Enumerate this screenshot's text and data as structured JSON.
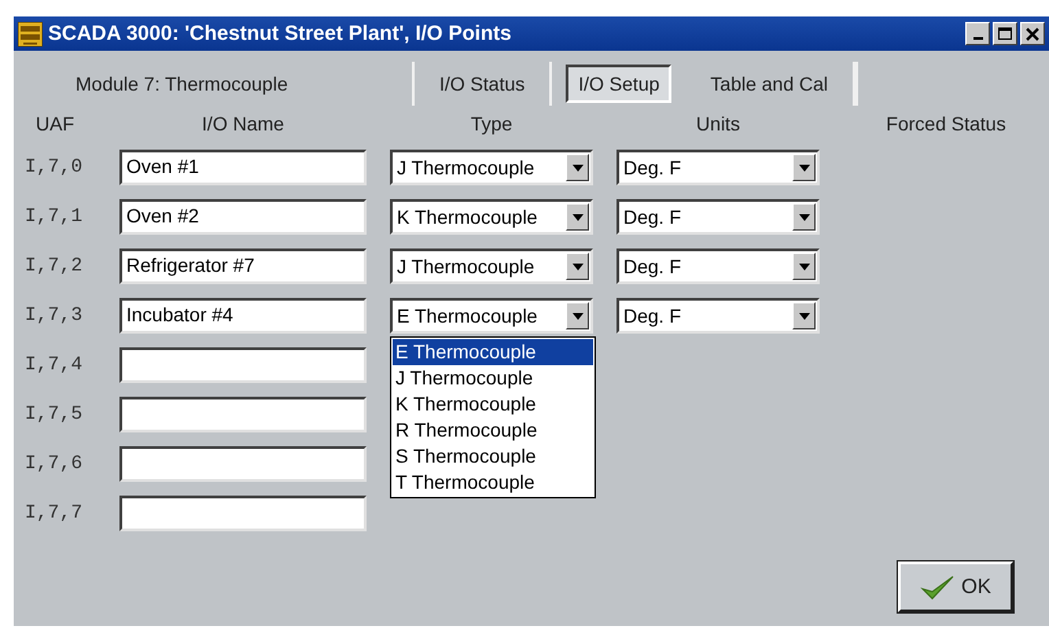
{
  "window": {
    "title": "SCADA 3000: 'Chestnut Street Plant', I/O Points"
  },
  "module_label": "Module 7: Thermocouple",
  "tabs": [
    {
      "label": "I/O Status",
      "selected": false
    },
    {
      "label": "I/O Setup",
      "selected": true
    },
    {
      "label": "Table and Cal",
      "selected": false
    }
  ],
  "columns": [
    "UAF",
    "I/O Name",
    "Type",
    "Units",
    "Forced Status"
  ],
  "rows": [
    {
      "uaf": "I,7,0",
      "name": "Oven #1",
      "type": "J Thermocouple",
      "units": "Deg. F"
    },
    {
      "uaf": "I,7,1",
      "name": "Oven #2",
      "type": "K Thermocouple",
      "units": "Deg. F"
    },
    {
      "uaf": "I,7,2",
      "name": "Refrigerator #7",
      "type": "J Thermocouple",
      "units": "Deg. F"
    },
    {
      "uaf": "I,7,3",
      "name": "Incubator #4",
      "type": "E Thermocouple",
      "units": "Deg. F",
      "type_options": [
        {
          "label": "E Thermocouple",
          "selected": true
        },
        {
          "label": "J Thermocouple",
          "selected": false
        },
        {
          "label": "K Thermocouple",
          "selected": false
        },
        {
          "label": "R Thermocouple",
          "selected": false
        },
        {
          "label": "S Thermocouple",
          "selected": false
        },
        {
          "label": "T Thermocouple",
          "selected": false
        }
      ]
    },
    {
      "uaf": "I,7,4"
    },
    {
      "uaf": "I,7,5"
    },
    {
      "uaf": "I,7,6"
    },
    {
      "uaf": "I,7,7"
    }
  ],
  "ok_button": {
    "label": "OK"
  }
}
